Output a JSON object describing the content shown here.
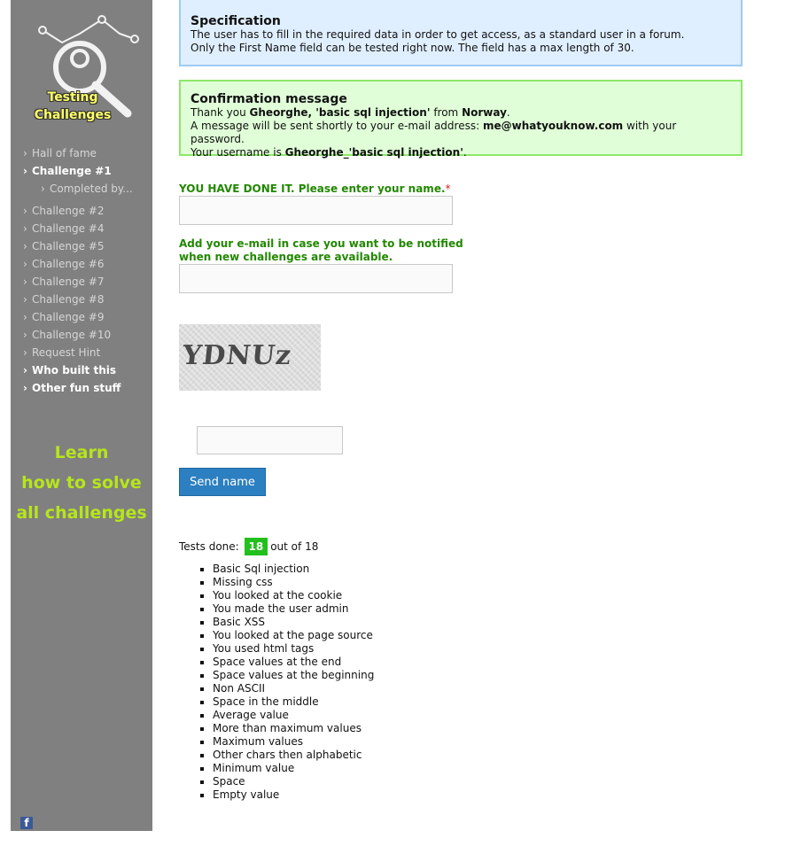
{
  "sidebar": {
    "logo_text": [
      "Testing",
      "Challenges"
    ],
    "nav": [
      {
        "label": "Hall of fame",
        "bold": false
      },
      {
        "label": "Challenge #1",
        "bold": true
      },
      {
        "label": "Completed by...",
        "bold": false,
        "sub": true
      },
      {
        "label": "Challenge #2",
        "bold": false,
        "gap": true
      },
      {
        "label": "Challenge #4",
        "bold": false
      },
      {
        "label": "Challenge #5",
        "bold": false
      },
      {
        "label": "Challenge #6",
        "bold": false
      },
      {
        "label": "Challenge #7",
        "bold": false
      },
      {
        "label": "Challenge #8",
        "bold": false
      },
      {
        "label": "Challenge #9",
        "bold": false
      },
      {
        "label": "Challenge #10",
        "bold": false
      },
      {
        "label": "Request Hint",
        "bold": false
      },
      {
        "label": "Who built this",
        "bold": true
      },
      {
        "label": "Other fun stuff",
        "bold": true
      }
    ],
    "learn": [
      "Learn",
      "how to solve",
      "all challenges"
    ],
    "facebook_icon": "facebook-icon"
  },
  "spec": {
    "title": "Specification",
    "line1": "The user has to fill in the required data in order to get access, as a standard user in a forum.",
    "line2": "Only the First Name field can be tested right now. The field has a max length of 30."
  },
  "confirm": {
    "title": "Confirmation message",
    "l1_pre": "Thank you ",
    "l1_name": "Gheorghe, 'basic sql injection'",
    "l1_mid": " from ",
    "l1_country": "Norway",
    "l1_end": ".",
    "l2_pre": "A message will be sent shortly to your e-mail address: ",
    "l2_email": "me@whatyouknow.com",
    "l2_end": " with your password.",
    "l3_pre": "Your username is ",
    "l3_user": "Gheorghe_'basic sql injection'",
    "l3_end": "."
  },
  "form": {
    "name_label": "YOU HAVE DONE IT. Please enter your name.",
    "required_mark": "*",
    "name_value": "",
    "email_label_1": "Add your e-mail in case you want to be notified",
    "email_label_2": "when new challenges are available.",
    "email_value": "",
    "captcha_text": "YDNUz",
    "captcha_value": "",
    "send_label": "Send name"
  },
  "tests": {
    "prefix": "Tests done:",
    "done": "18",
    "suffix": "out of 18",
    "items": [
      "Basic Sql injection",
      "Missing css",
      "You looked at the cookie",
      "You made the user admin",
      "Basic XSS",
      "You looked at the page source",
      "You used html tags",
      "Space values at the end",
      "Space values at the beginning",
      "Non ASCII",
      "Space in the middle",
      "Average value",
      "More than maximum values",
      "Maximum values",
      "Other chars then alphabetic",
      "Minimum value",
      "Space",
      "Empty value"
    ]
  },
  "colors": {
    "sidebar_bg": "#808080",
    "accent_green": "#22c01c",
    "label_green": "#228800",
    "button_blue": "#2c7fc0",
    "learn_green": "#b6e61a"
  }
}
